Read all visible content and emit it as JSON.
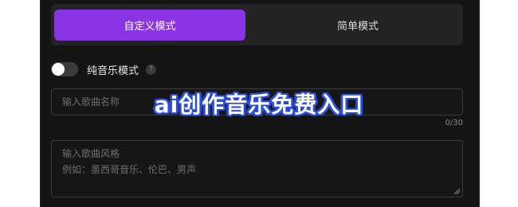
{
  "mode_switch": {
    "custom_label": "自定义模式",
    "simple_label": "简单模式",
    "active": "custom"
  },
  "pure_music": {
    "label": "纯音乐模式",
    "enabled": false,
    "help_icon": "question-circle-icon"
  },
  "song_name": {
    "placeholder": "输入歌曲名称",
    "value": "",
    "counter": "0/30"
  },
  "song_style": {
    "placeholder": "输入歌曲风格\n例如：墨西哥音乐、伦巴、男声",
    "value": ""
  },
  "overlay": {
    "text": "ai创作音乐免费入口"
  },
  "colors": {
    "accent": "#8a34e6",
    "panel_bg": "#141414",
    "overlay_stroke": "#2a4fd6"
  }
}
